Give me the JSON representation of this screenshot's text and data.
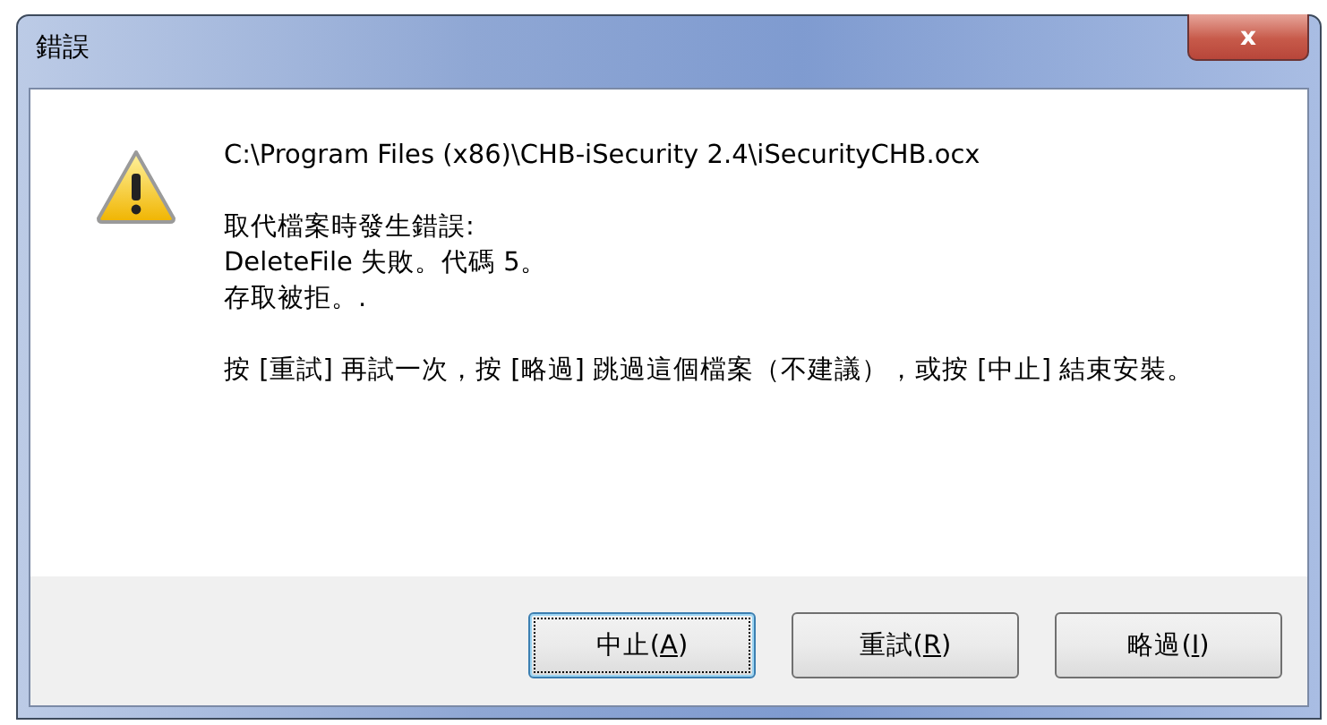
{
  "window": {
    "title": "錯誤",
    "close": "x"
  },
  "message": {
    "path": "C:\\Program Files (x86)\\CHB-iSecurity 2.4\\iSecurityCHB.ocx",
    "lines": [
      "取代檔案時發生錯誤:",
      "DeleteFile 失敗。代碼 5。",
      "存取被拒。."
    ],
    "instruction": "按 [重試] 再試一次，按 [略過] 跳過這個檔案（不建議），或按 [中止] 結束安裝。"
  },
  "buttons": [
    {
      "before": "中止(",
      "key": "A",
      "after": ")",
      "focused": true
    },
    {
      "before": "重試(",
      "key": "R",
      "after": ")",
      "focused": false
    },
    {
      "before": "略過(",
      "key": "I",
      "after": ")",
      "focused": false
    }
  ]
}
